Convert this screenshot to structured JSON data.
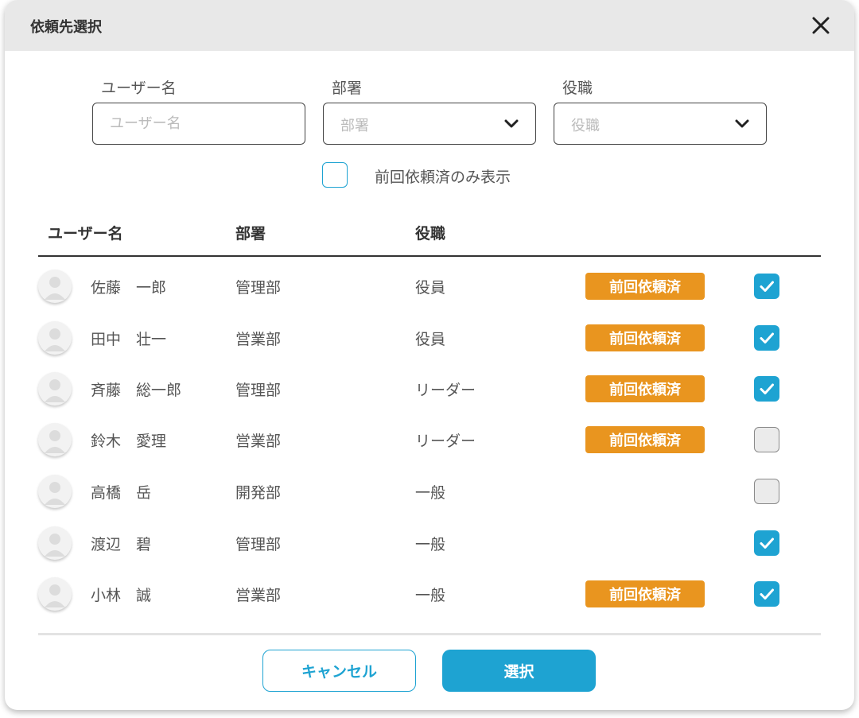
{
  "dialog": {
    "title": "依頼先選択"
  },
  "filters": {
    "username": {
      "label": "ユーザー名",
      "placeholder": "ユーザー名",
      "value": ""
    },
    "department": {
      "label": "部署",
      "placeholder": "部署"
    },
    "position": {
      "label": "役職",
      "placeholder": "役職"
    },
    "previous_only": {
      "label": "前回依頼済のみ表示",
      "checked": false
    }
  },
  "table": {
    "columns": [
      "ユーザー名",
      "部署",
      "役職"
    ],
    "badge_label": "前回依頼済",
    "rows": [
      {
        "name": "佐藤　一郎",
        "department": "管理部",
        "position": "役員",
        "previous": true,
        "checked": true
      },
      {
        "name": "田中　壮一",
        "department": "営業部",
        "position": "役員",
        "previous": true,
        "checked": true
      },
      {
        "name": "斉藤　総一郎",
        "department": "管理部",
        "position": "リーダー",
        "previous": true,
        "checked": true
      },
      {
        "name": "鈴木　愛理",
        "department": "営業部",
        "position": "リーダー",
        "previous": true,
        "checked": false
      },
      {
        "name": "高橋　岳",
        "department": "開発部",
        "position": "一般",
        "previous": false,
        "checked": false
      },
      {
        "name": "渡辺　碧",
        "department": "管理部",
        "position": "一般",
        "previous": false,
        "checked": true
      },
      {
        "name": "小林　誠",
        "department": "営業部",
        "position": "一般",
        "previous": true,
        "checked": true
      }
    ]
  },
  "buttons": {
    "cancel": "キャンセル",
    "select": "選択"
  },
  "icons": {
    "close": "close-icon",
    "chevron": "chevron-down-icon",
    "check": "check-icon",
    "avatar": "user-avatar-icon"
  },
  "colors": {
    "accent": "#1ea3d2",
    "badge": "#e9951f",
    "header_bg": "#e8e8e8"
  }
}
